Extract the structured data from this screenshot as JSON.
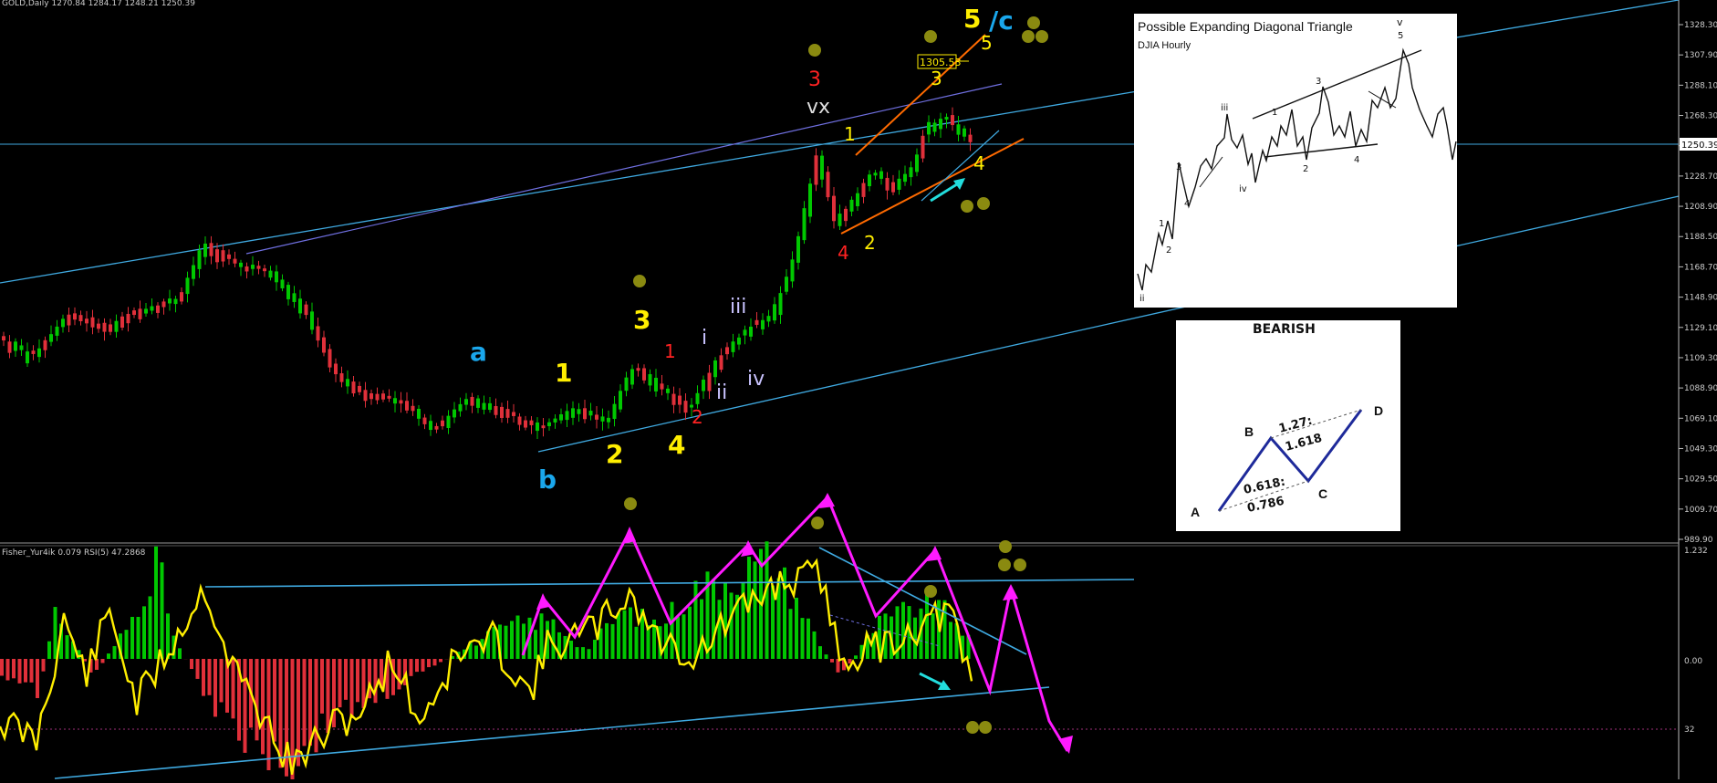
{
  "main_chart": {
    "header": "GOLD,Daily  1270.84 1284.17 1248.21 1250.39",
    "symbol": "GOLD",
    "timeframe": "Daily",
    "ohlc": {
      "open": 1270.84,
      "high": 1284.17,
      "low": 1248.21,
      "close": 1250.39
    },
    "current_price_label": "1250.39",
    "price_box_label": "1305.53",
    "axis_ticks": [
      "1328.30",
      "1307.90",
      "1288.10",
      "1268.30",
      "1248.50",
      "1228.70",
      "1208.90",
      "1188.50",
      "1168.70",
      "1148.90",
      "1129.10",
      "1109.30",
      "1088.90",
      "1069.10",
      "1049.30",
      "1029.50",
      "1009.70",
      "989.90"
    ]
  },
  "wave_labels": {
    "a": "a",
    "b": "b",
    "y1": "1",
    "y2": "2",
    "y3": "3",
    "y4": "4",
    "y5": "5",
    "slash_c": "/c",
    "r1": "1",
    "r2": "2",
    "r3": "3",
    "r4": "4",
    "i": "i",
    "ii": "ii",
    "iii": "iii",
    "iv": "iv",
    "vx": "vx",
    "s1": "1",
    "s2": "2",
    "s3": "3",
    "s4": "4",
    "s5": "5"
  },
  "indicator": {
    "header": "Fisher_Yur4ik 0.079  RSI(5) 47.2868",
    "axis_ticks": [
      "1.232",
      "0.00",
      "32"
    ]
  },
  "inset_triangle": {
    "title": "Possible Expanding Diagonal Triangle",
    "subtitle": "DJIA Hourly",
    "wave_marks": [
      "ii",
      "1",
      "2",
      "3",
      "4",
      "iii",
      "iv",
      "1",
      "2",
      "3",
      "4",
      "v",
      "5"
    ]
  },
  "inset_bearish": {
    "title": "BEARISH",
    "points": {
      "a": "A",
      "b": "B",
      "c": "C",
      "d": "D"
    },
    "ratio_ab_bc": "0.618:",
    "ratio_ab_bc_2": "0.786",
    "ratio_bc_cd": "1.27:",
    "ratio_bc_cd_2": "1.618"
  },
  "colors": {
    "bull_candle": "#00c800",
    "bear_candle": "#e0303a",
    "channel": "#3fa9e0",
    "inner_channel": "#6f6fe0",
    "wedge": "#ff6a00",
    "wave_yellow": "#ffee00",
    "wave_red": "#ff2222",
    "wave_blue": "#1aa7ec",
    "wave_lavender": "#c9c3ff",
    "dots": "#8a8a10",
    "magenta": "#ff1aff",
    "cyan_arrow": "#22dddd",
    "rsi_line": "#ffee00"
  }
}
